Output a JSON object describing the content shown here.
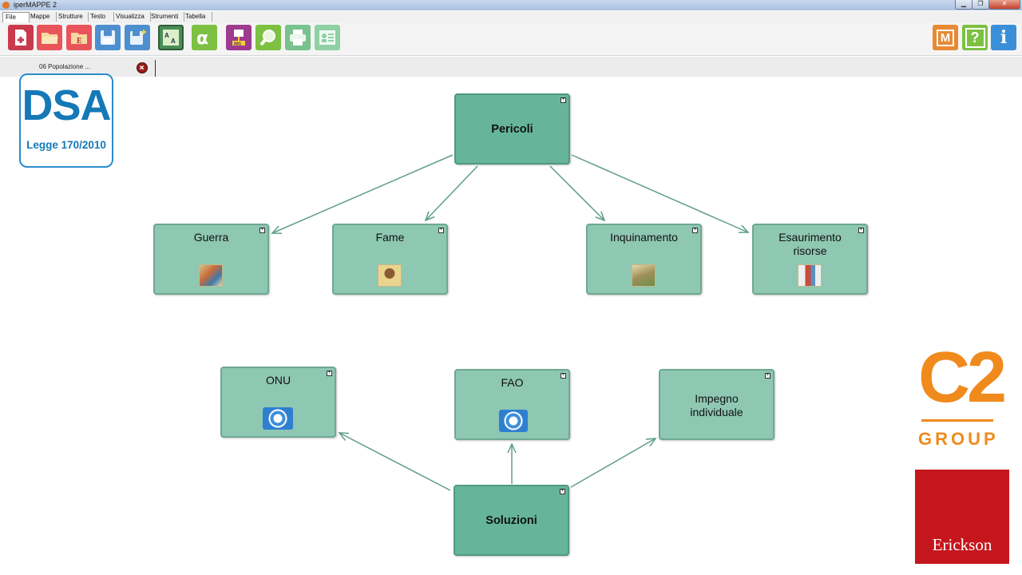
{
  "window": {
    "title": "iperMAPPE 2",
    "min": "▁",
    "max": "❐",
    "close": "✕"
  },
  "menu": {
    "items": [
      "File",
      "Mappe",
      "Strutture",
      "Testo",
      "Visualizza",
      "Strumenti",
      "Tabella"
    ]
  },
  "toolbar": {
    "tools": [
      {
        "name": "new-map",
        "icon": "new-document-icon",
        "color": "#c93a4c"
      },
      {
        "name": "open",
        "icon": "folder-open-icon",
        "color": "#d8454f"
      },
      {
        "name": "open-e",
        "icon": "folder-e-icon",
        "color": "#d8454f"
      },
      {
        "name": "save",
        "icon": "floppy-icon",
        "color": "#4e8fd0"
      },
      {
        "name": "save-as",
        "icon": "floppy-plus-icon",
        "color": "#4e8fd0"
      },
      {
        "name": "text-style",
        "icon": "abc-icon",
        "color": "#4a8c55"
      },
      {
        "name": "alpha",
        "icon": "alpha-icon",
        "color": "#7cc142"
      },
      {
        "name": "insert-image",
        "icon": "insert-image-icon",
        "color": "#9d3b8f"
      },
      {
        "name": "zoom",
        "icon": "magnifier-icon",
        "color": "#7cc142"
      },
      {
        "name": "print",
        "icon": "printer-icon",
        "color": "#78c28d"
      },
      {
        "name": "contacts",
        "icon": "contact-card-icon",
        "color": "#8fd0a5"
      }
    ],
    "right_tools": [
      {
        "name": "mappe-m",
        "label": "M",
        "icon": "m-icon",
        "color": "#e78a34"
      },
      {
        "name": "help",
        "label": "?",
        "icon": "help-icon",
        "color": "#7cc142"
      },
      {
        "name": "info",
        "label": "i",
        "icon": "info-icon",
        "color": "#3a8fd8"
      }
    ]
  },
  "tab": {
    "label": "06 Popolazione ..."
  },
  "map": {
    "nodes": {
      "pericoli": "Pericoli",
      "guerra": "Guerra",
      "fame": "Fame",
      "inquinamento": "Inquinamento",
      "esaurimento": "Esaurimento\nrisorse",
      "onu": "ONU",
      "fao": "FAO",
      "impegno": "Impegno\nindividuale",
      "soluzioni": "Soluzioni"
    },
    "colors": {
      "node": "#8ec7b2",
      "main_node": "#66b59a",
      "edge": "#5f9e86"
    }
  },
  "logos": {
    "dsa": {
      "big": "DSA",
      "small": "Legge 170/2010"
    },
    "c2": {
      "big": "C2",
      "group": "GROUP"
    },
    "erickson": {
      "text": "Erickson"
    }
  }
}
